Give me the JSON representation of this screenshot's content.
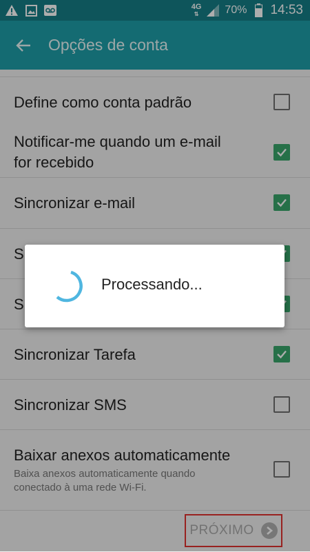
{
  "status_bar": {
    "network": "4G",
    "battery": "70%",
    "time": "14:53",
    "icons": [
      "warning-icon",
      "image-icon",
      "voicemail-icon"
    ]
  },
  "app_bar": {
    "title": "Opções de conta",
    "back_icon": "arrow-back-icon"
  },
  "settings": [
    {
      "label": "Define como conta padrão",
      "checked": false
    },
    {
      "label": "Notificar-me quando um e-mail\nfor recebido",
      "checked": true
    },
    {
      "label": "Sincronizar e-mail",
      "checked": true
    },
    {
      "label": "S",
      "checked": true
    },
    {
      "label": "S",
      "checked": true
    },
    {
      "label": "Sincronizar Tarefa",
      "checked": true
    },
    {
      "label": "Sincronizar SMS",
      "checked": false
    },
    {
      "label": "Baixar anexos automaticamente",
      "sublabel": "Baixa anexos automaticamente quando\nconectado à uma rede Wi-Fi.",
      "checked": false
    }
  ],
  "footer": {
    "next_label": "PRÓXIMO"
  },
  "dialog": {
    "message": "Processando..."
  },
  "colors": {
    "statusbar": "#157e87",
    "appbar": "#1e9ea8",
    "check": "#39a56b",
    "spinner": "#4fb6e0",
    "highlight": "#e0312f"
  }
}
